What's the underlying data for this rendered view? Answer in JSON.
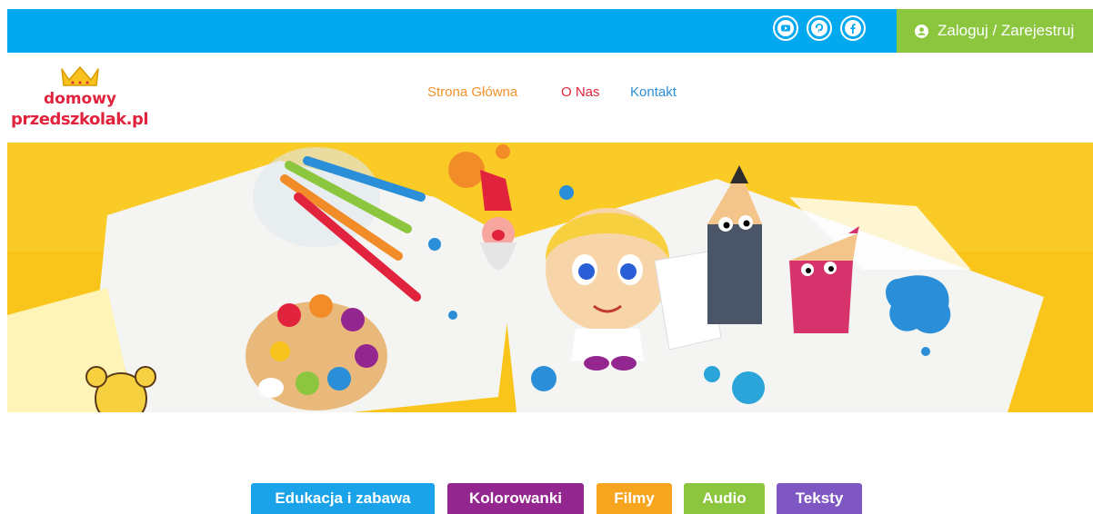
{
  "topbar": {
    "social": [
      {
        "name": "youtube-icon"
      },
      {
        "name": "pinterest-icon"
      },
      {
        "name": "facebook-icon"
      }
    ],
    "login_label": "Zaloguj / Zarejestruj"
  },
  "logo": {
    "line1": "domowy",
    "line2": "przedszkolak.pl"
  },
  "nav": {
    "items": [
      {
        "label": "Strona Główna",
        "color": "#f0922b"
      },
      {
        "label": "O Nas",
        "color": "#e2233d"
      },
      {
        "label": "Kontakt",
        "color": "#2a8fd8"
      }
    ]
  },
  "categories": [
    {
      "label": "Edukacja i zabawa",
      "color": "#1aa3e8"
    },
    {
      "label": "Kolorowanki",
      "color": "#93278f"
    },
    {
      "label": "Filmy",
      "color": "#f7a51e"
    },
    {
      "label": "Audio",
      "color": "#8cc63f"
    },
    {
      "label": "Teksty",
      "color": "#7e57c2"
    }
  ],
  "colors": {
    "topbar": "#03a9ef",
    "login": "#8cc63f",
    "hero_bg": "#f9c51b"
  }
}
